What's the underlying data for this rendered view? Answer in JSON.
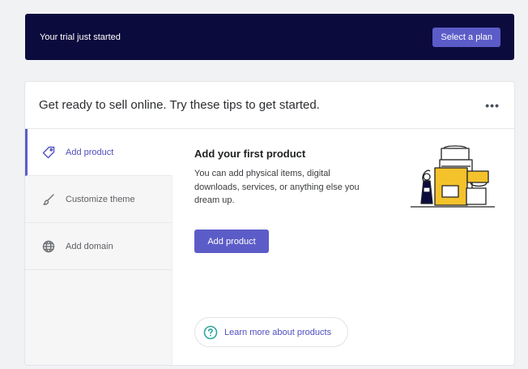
{
  "banner": {
    "text": "Your trial just started",
    "button_label": "Select a plan"
  },
  "card": {
    "title": "Get ready to sell online. Try these tips to get started.",
    "more_label": "•••"
  },
  "sidebar": {
    "items": [
      {
        "label": "Add product",
        "icon": "tag-icon",
        "active": true
      },
      {
        "label": "Customize theme",
        "icon": "brush-icon",
        "active": false
      },
      {
        "label": "Add domain",
        "icon": "globe-icon",
        "active": false
      }
    ]
  },
  "content": {
    "title": "Add your first product",
    "description": "You can add physical items, digital downloads, services, or anything else you dream up.",
    "button_label": "Add product",
    "learn_more_label": "Learn more about products",
    "learn_more_icon": "help-circle-icon"
  },
  "colors": {
    "banner_bg": "#0c0b3e",
    "accent": "#5c5cc8",
    "teal": "#47c1bf",
    "yellow": "#f4c22b"
  }
}
